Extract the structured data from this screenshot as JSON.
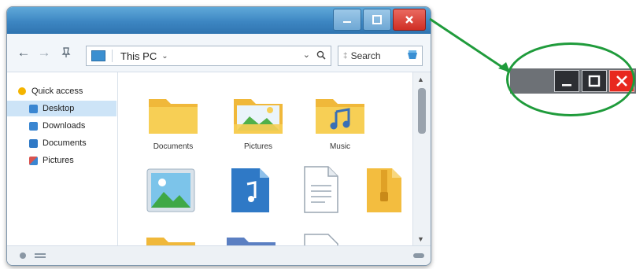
{
  "window": {
    "controls": {
      "minimize": "minimize-icon",
      "maximize": "maximize-icon",
      "close": "close-icon"
    }
  },
  "toolbar": {
    "back_icon": "arrow-left-icon",
    "forward_icon": "arrow-right-icon",
    "pin_icon": "pin-icon",
    "address": {
      "icon": "this-pc-icon",
      "text": "This PC"
    },
    "search": {
      "placeholder": "Search"
    }
  },
  "sidebar": {
    "items": [
      {
        "label": "Quick access",
        "icon": "star-icon"
      },
      {
        "label": "Desktop",
        "icon": "desktop-icon",
        "color": "#3a86d1",
        "selected": true
      },
      {
        "label": "Downloads",
        "icon": "download-icon",
        "color": "#3a86d1"
      },
      {
        "label": "Documents",
        "icon": "documents-icon",
        "color": "#2f79c6"
      },
      {
        "label": "Pictures",
        "icon": "pictures-icon",
        "color": "#d9534f"
      }
    ]
  },
  "content": {
    "items": [
      {
        "label": "Documents",
        "icon": "folder-icon"
      },
      {
        "label": "Pictures",
        "icon": "pictures-folder-icon"
      },
      {
        "label": "Music",
        "icon": "music-folder-icon"
      },
      {
        "label": "",
        "icon": "image-file-icon"
      },
      {
        "label": "",
        "icon": "music-file-icon"
      },
      {
        "label": "",
        "icon": "text-file-icon"
      },
      {
        "label": "",
        "icon": "zip-folder-icon"
      }
    ]
  },
  "callout": {
    "description_icons": [
      "minimize-icon",
      "maximize-icon",
      "close-icon"
    ]
  },
  "colors": {
    "titlebar": "#3d86c2",
    "close": "#e8281e",
    "callout_border": "#1f9b3b",
    "folder": "#f5c542"
  }
}
